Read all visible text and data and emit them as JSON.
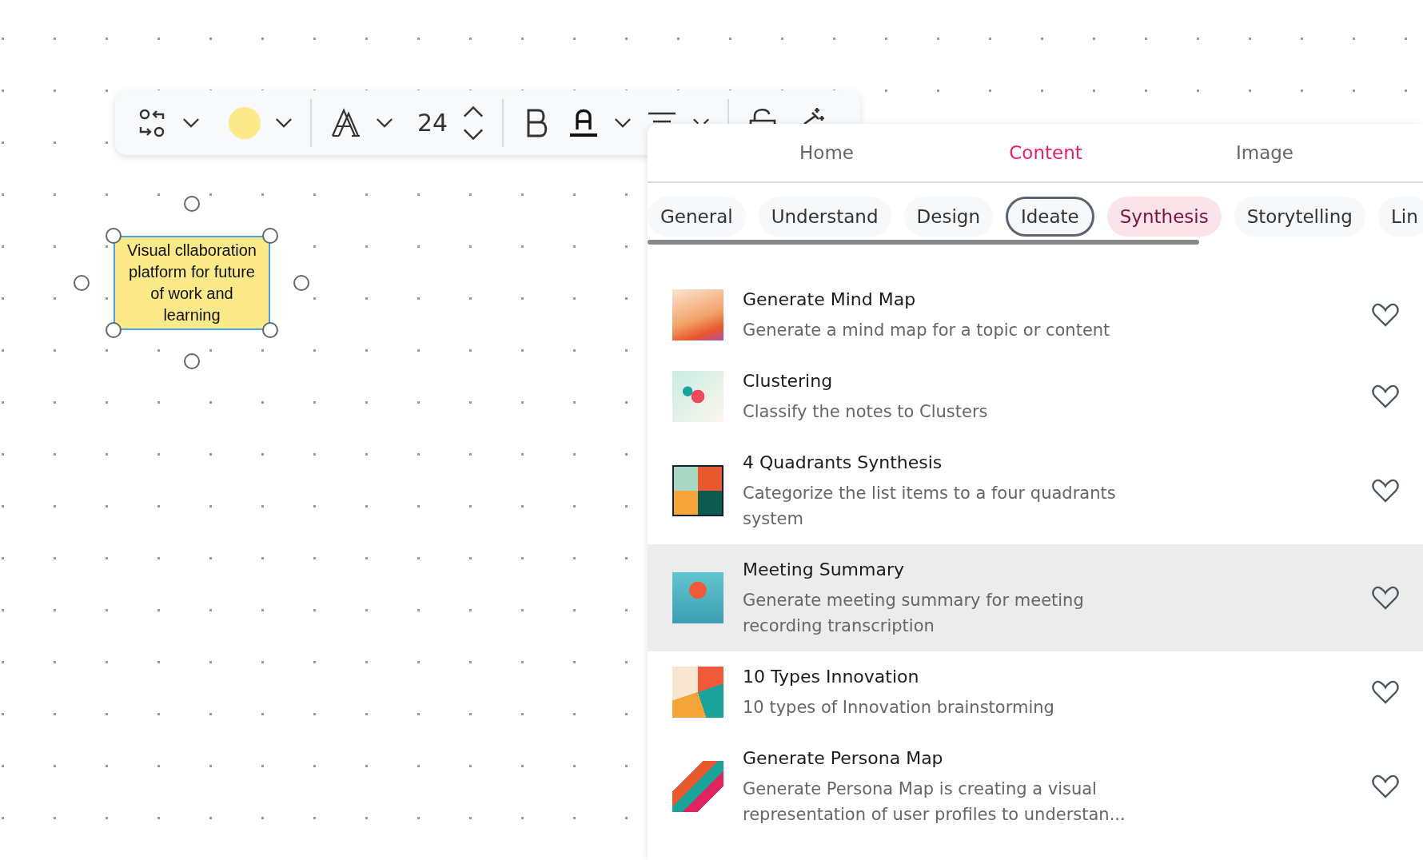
{
  "note": {
    "text": "Visual cllaboration platform for future of work and learning"
  },
  "toolbar": {
    "font_size": "24"
  },
  "panel": {
    "tabs": [
      {
        "label": "Home",
        "selected": false
      },
      {
        "label": "Content",
        "selected": true
      },
      {
        "label": "Image",
        "selected": false
      }
    ],
    "categories": [
      {
        "label": "General",
        "selected": false,
        "focused": false
      },
      {
        "label": "Understand",
        "selected": false,
        "focused": false
      },
      {
        "label": "Design",
        "selected": false,
        "focused": false
      },
      {
        "label": "Ideate",
        "selected": false,
        "focused": true
      },
      {
        "label": "Synthesis",
        "selected": true,
        "focused": false
      },
      {
        "label": "Storytelling",
        "selected": false,
        "focused": false
      },
      {
        "label": "Lin",
        "selected": false,
        "focused": false
      }
    ],
    "items": [
      {
        "title": "Generate Mind Map",
        "description": "Generate a mind map for a topic or content",
        "favorite": false,
        "hovered": false
      },
      {
        "title": "Clustering",
        "description": "Classify the notes to Clusters",
        "favorite": false,
        "hovered": false
      },
      {
        "title": "4 Quadrants Synthesis",
        "description": "Categorize the list items to a four quadrants system",
        "favorite": false,
        "hovered": false
      },
      {
        "title": "Meeting Summary",
        "description": "Generate meeting summary for meeting recording transcription",
        "favorite": false,
        "hovered": true
      },
      {
        "title": "10 Types Innovation",
        "description": "10 types of Innovation brainstorming",
        "favorite": false,
        "hovered": false
      },
      {
        "title": "Generate Persona Map",
        "description": "Generate Persona Map is creating a visual representation of user profiles to understan...",
        "favorite": false,
        "hovered": false
      }
    ]
  }
}
